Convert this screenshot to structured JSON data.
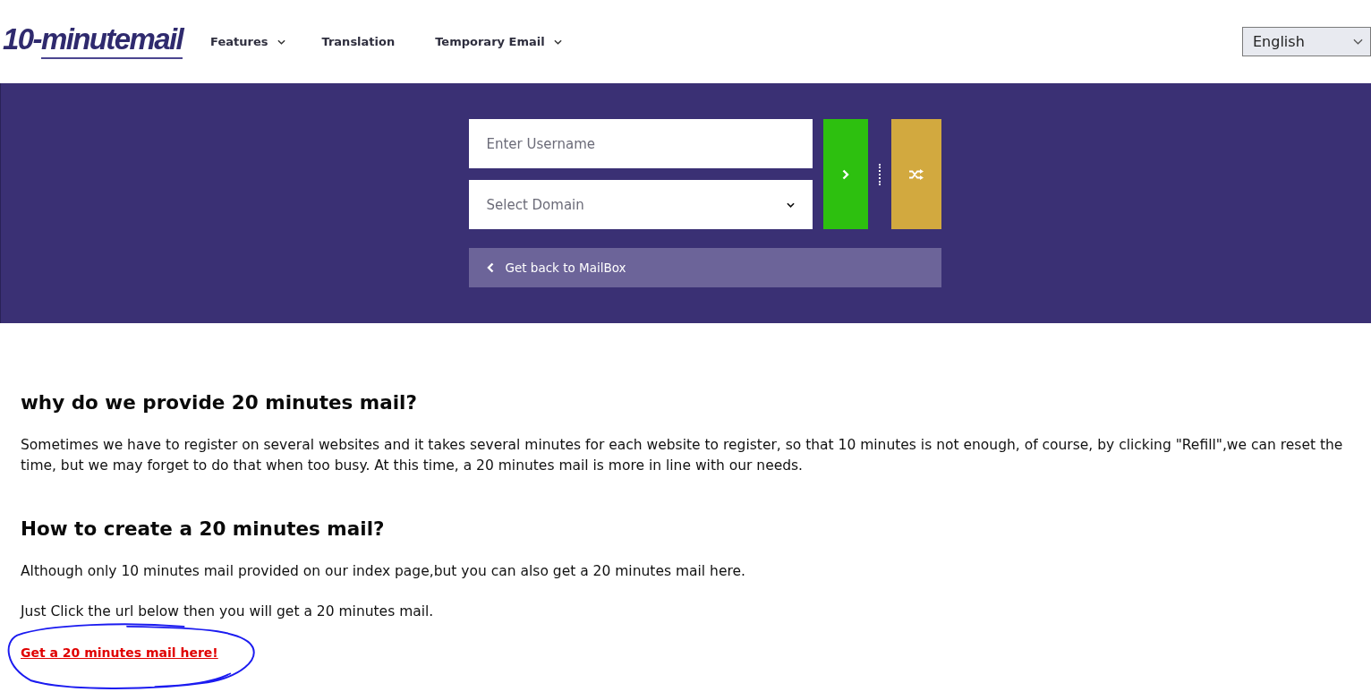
{
  "header": {
    "logo": {
      "prefix": "10-",
      "name": "minutemail"
    },
    "nav": [
      {
        "label": "Features",
        "dropdown": true
      },
      {
        "label": "Translation",
        "dropdown": false
      },
      {
        "label": "Temporary Email",
        "dropdown": true
      }
    ],
    "language": {
      "value": "English"
    }
  },
  "hero": {
    "username": {
      "placeholder": "Enter Username"
    },
    "domain": {
      "placeholder": "Select Domain"
    },
    "back_link": {
      "label": "Get back to MailBox"
    }
  },
  "content": {
    "sections": [
      {
        "heading": "why do we provide 20 minutes mail?",
        "paragraphs": [
          "Sometimes we have to register on several websites and it takes several minutes for each website to register, so that 10 minutes is not enough, of course, by clicking \"Refill\",we can reset the time, but we may forget to do that when too busy. At this time, a 20 minutes mail is more in line with our needs."
        ]
      },
      {
        "heading": "How to create a 20 minutes mail?",
        "paragraphs": [
          "Although only 10 minutes mail provided on our index page,but you can also get a 20 minutes mail here.",
          "Just Click the url below then you will get a 20 minutes mail."
        ]
      }
    ],
    "link": "Get a 20 minutes mail here!"
  }
}
